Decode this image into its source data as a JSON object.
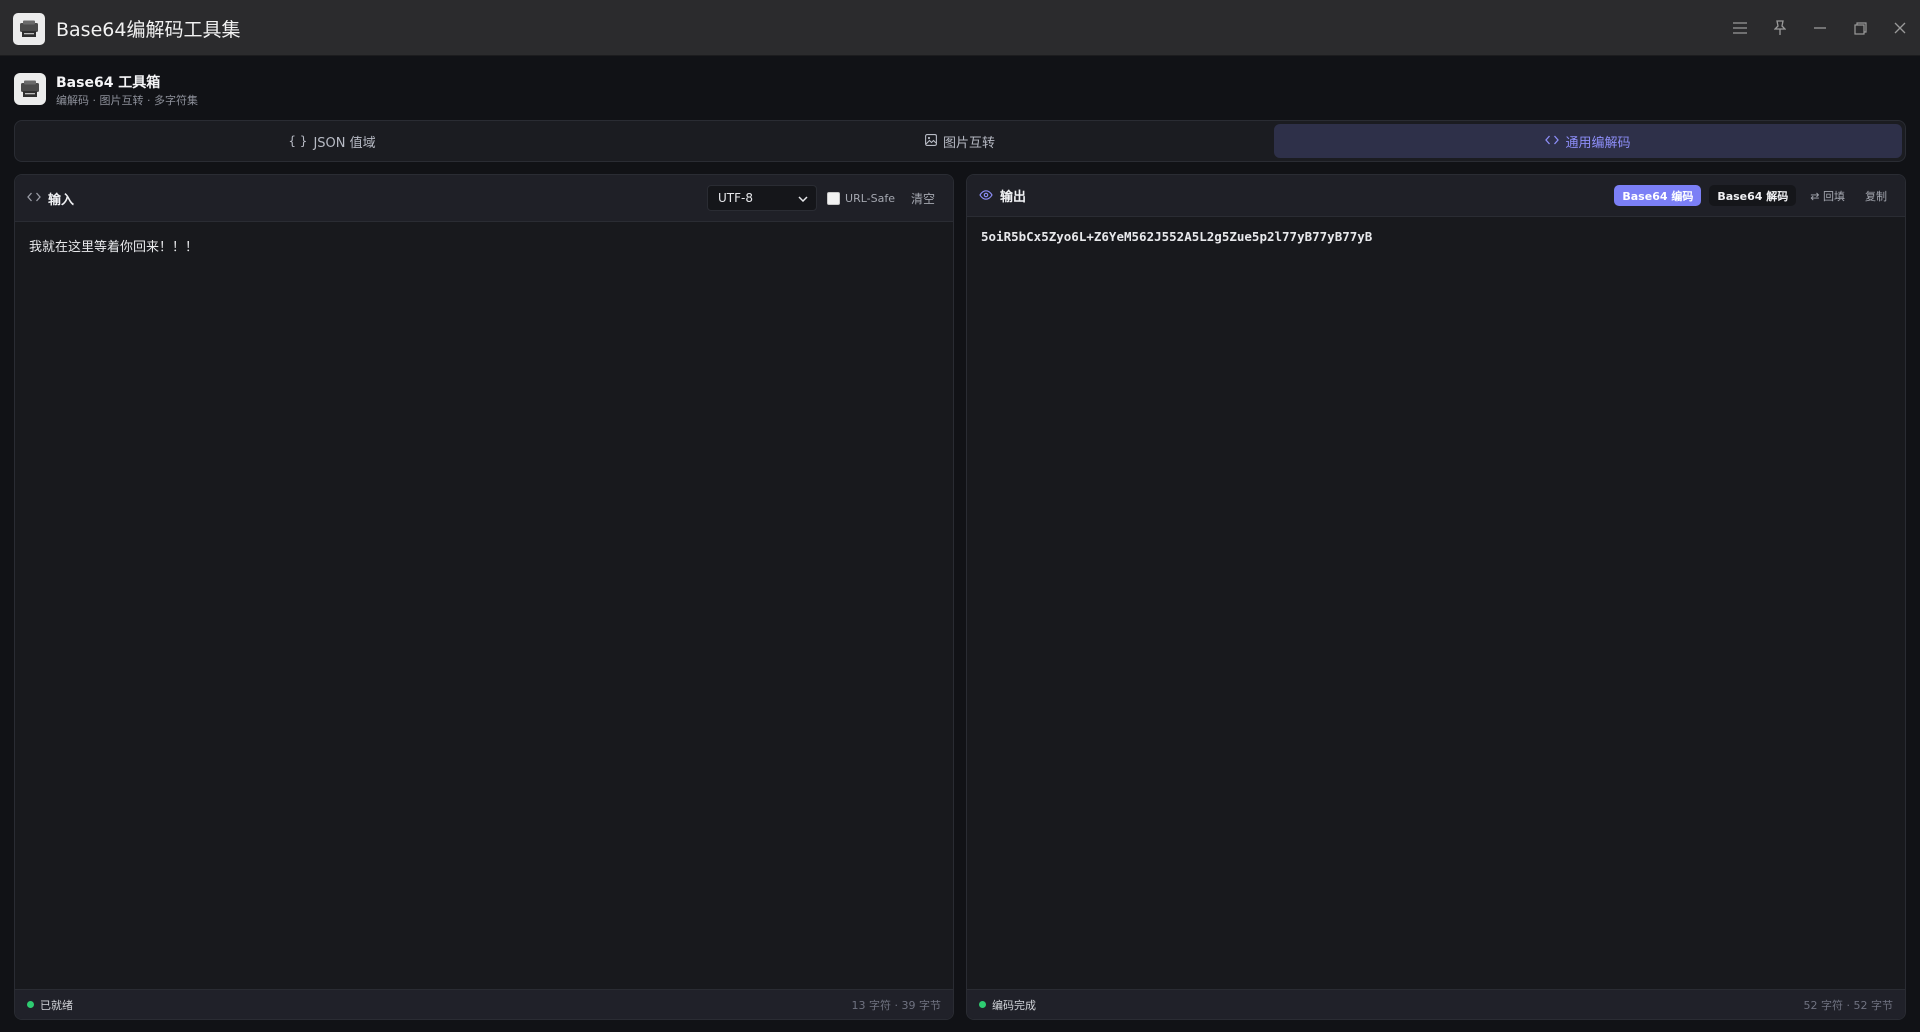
{
  "window": {
    "title": "Base64编解码工具集",
    "controls": [
      "menu-icon",
      "pin-icon",
      "minimize-icon",
      "restore-icon",
      "close-icon"
    ]
  },
  "header": {
    "name": "Base64 工具箱",
    "subtitle": "编解码 · 图片互转 · 多字符集"
  },
  "tabs": [
    {
      "icon": "{ }",
      "label": "JSON 值域",
      "active": false
    },
    {
      "icon": "▣",
      "label": "图片互转",
      "active": false
    },
    {
      "icon": "‹›",
      "label": "通用编解码",
      "active": true
    }
  ],
  "input_panel": {
    "title": "输入",
    "charset": "UTF-8",
    "url_safe_label": "URL-Safe",
    "url_safe_checked": false,
    "clear_label": "清空",
    "text": "我就在这里等着你回来！！！",
    "status": "已就绪",
    "stats": "13 字符 · 39 字节"
  },
  "output_panel": {
    "title": "输出",
    "encode_label": "Base64 编码",
    "decode_label": "Base64 解码",
    "backfill_label": "⇄ 回填",
    "copy_label": "复制",
    "text": "5oiR5bCx5Zyo6L+Z6YeM562J552A5L2g5Zue5p2l77yB77yB77yB",
    "status": "编码完成",
    "stats": "52 字符 · 52 字节"
  },
  "colors": {
    "accent": "#7b7ff6",
    "status_ok": "#2ecc71",
    "bg": "#111216",
    "panel": "#18191d"
  }
}
